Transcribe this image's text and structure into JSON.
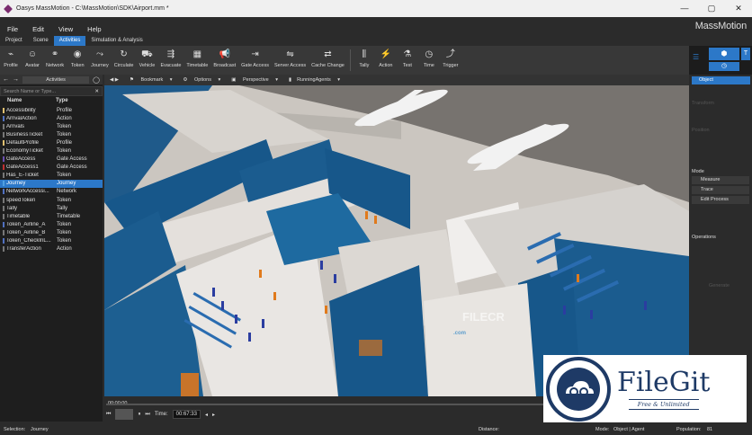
{
  "window": {
    "title": "Oasys MassMotion - C:\\MassMotion\\SDK\\Airport.mm *",
    "brand": "MassMotion"
  },
  "menu": [
    "File",
    "Edit",
    "View",
    "Help"
  ],
  "ribbon_tabs": [
    {
      "label": "Project",
      "active": false
    },
    {
      "label": "Scene",
      "active": false
    },
    {
      "label": "Activities",
      "active": true
    },
    {
      "label": "Simulation & Analysis",
      "active": false
    }
  ],
  "tools": [
    {
      "label": "Profile",
      "icon": "profile-icon",
      "glyph": "⌁"
    },
    {
      "label": "Avatar",
      "icon": "avatar-icon",
      "glyph": "☺"
    },
    {
      "label": "Network",
      "icon": "network-icon",
      "glyph": "⚭"
    },
    {
      "label": "Token",
      "icon": "token-icon",
      "glyph": "◉"
    },
    {
      "label": "Journey",
      "icon": "journey-icon",
      "glyph": "⤳"
    },
    {
      "label": "Circulate",
      "icon": "circulate-icon",
      "glyph": "↻"
    },
    {
      "label": "Vehicle",
      "icon": "vehicle-icon",
      "glyph": "⛟"
    },
    {
      "label": "Evacuate",
      "icon": "evacuate-icon",
      "glyph": "⇶"
    },
    {
      "label": "Timetable",
      "icon": "timetable-icon",
      "glyph": "▦"
    },
    {
      "label": "Broadcast",
      "icon": "broadcast-icon",
      "glyph": "📢"
    },
    {
      "label": "Gate Access",
      "icon": "gate-access-icon",
      "glyph": "⇥"
    },
    {
      "label": "Server Access",
      "icon": "server-access-icon",
      "glyph": "⇋"
    },
    {
      "label": "Cache Change",
      "icon": "cache-change-icon",
      "glyph": "⇄"
    },
    {
      "label": "Tally",
      "icon": "tally-icon",
      "glyph": "⫼"
    },
    {
      "label": "Action",
      "icon": "action-icon",
      "glyph": "⚡"
    },
    {
      "label": "Test",
      "icon": "test-icon",
      "glyph": "⚗"
    },
    {
      "label": "Time",
      "icon": "clock-icon",
      "glyph": "◷"
    },
    {
      "label": "Trigger",
      "icon": "trigger-icon",
      "glyph": "⤴"
    }
  ],
  "left_panel": {
    "dropdown": "Activities",
    "search_placeholder": "Search Name or Type...",
    "col_name": "Name",
    "col_type": "Type",
    "rows": [
      {
        "name": "Accessibility",
        "type": "Profile",
        "color": "#e0c070"
      },
      {
        "name": "ArrivalAction",
        "type": "Action",
        "color": "#5070c0"
      },
      {
        "name": "Arrivals",
        "type": "Token",
        "color": "#777777"
      },
      {
        "name": "BusinessTicket",
        "type": "Token",
        "color": "#777777"
      },
      {
        "name": "DefaultProfile",
        "type": "Profile",
        "color": "#e0c070"
      },
      {
        "name": "EconomyTicket",
        "type": "Token",
        "color": "#777777"
      },
      {
        "name": "GateAccess",
        "type": "Gate Access",
        "color": "#6a4fb0"
      },
      {
        "name": "GateAccess1",
        "type": "Gate Access",
        "color": "#c03030"
      },
      {
        "name": "Has_E-Ticket",
        "type": "Token",
        "color": "#777777"
      },
      {
        "name": "Journey",
        "type": "Journey",
        "color": "#50a0e0",
        "selected": true
      },
      {
        "name": "NetworkAccessi...",
        "type": "Network",
        "color": "#5070c0"
      },
      {
        "name": "speedToken",
        "type": "Token",
        "color": "#777777"
      },
      {
        "name": "Tally",
        "type": "Tally",
        "color": "#777777"
      },
      {
        "name": "Timetable",
        "type": "Timetable",
        "color": "#777777"
      },
      {
        "name": "Token_Airline_A",
        "type": "Token",
        "color": "#5070c0"
      },
      {
        "name": "Token_Airline_B",
        "type": "Token",
        "color": "#777777"
      },
      {
        "name": "Token_CheckInL...",
        "type": "Token",
        "color": "#5070c0"
      },
      {
        "name": "TransferAction",
        "type": "Action",
        "color": "#777777"
      }
    ]
  },
  "view_toolbar": [
    "Bookmark",
    "Options",
    "Perspective",
    "RunningAgents"
  ],
  "timeline": {
    "start": "00:00:00",
    "time_label": "Time:",
    "time_value": "00:67:33"
  },
  "right_panel": {
    "selection": "Object",
    "sections": [
      "Transform",
      "Position",
      "Mode",
      "Operations"
    ],
    "mode_buttons": [
      "Measure",
      "Trace",
      "Edit Process"
    ],
    "generate": "Generate"
  },
  "status": {
    "selection_label": "Selection:",
    "selection_value": "Journey",
    "distance_label": "Distance:",
    "mode_label": "Mode:",
    "mode_value": "Object | Agent",
    "population_label": "Population:",
    "population_value": "81"
  },
  "watermark": {
    "filecr": "FILECR",
    "filecr_sub": ".com",
    "filegit": "FileGit",
    "filegit_sub": "Free & Unlimited"
  }
}
